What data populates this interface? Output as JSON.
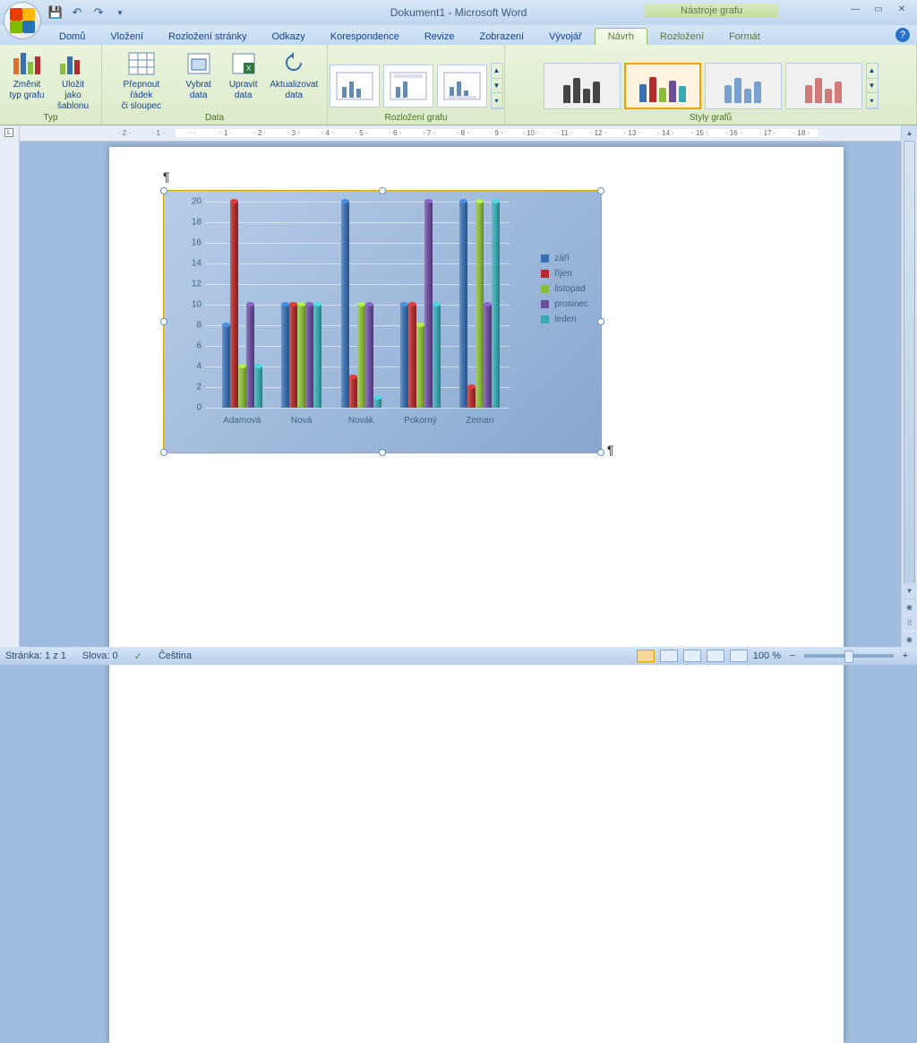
{
  "title": "Dokument1 - Microsoft Word",
  "context_tab_group": "Nástroje grafu",
  "tabs": [
    "Domů",
    "Vložení",
    "Rozložení stránky",
    "Odkazy",
    "Korespondence",
    "Revize",
    "Zobrazení",
    "Vývojář",
    "Návrh",
    "Rozložení",
    "Formát"
  ],
  "active_tab": "Návrh",
  "ribbon": {
    "groups": {
      "typ": {
        "label": "Typ",
        "btn_change": "Změnit\ntyp grafu",
        "btn_save": "Uložit jako\nšablonu"
      },
      "data": {
        "label": "Data",
        "btn_switch": "Přepnout řádek\nči sloupec",
        "btn_select": "Vybrat\ndata",
        "btn_edit": "Upravit\ndata",
        "btn_refresh": "Aktualizovat\ndata"
      },
      "layout": {
        "label": "Rozložení grafu"
      },
      "styles": {
        "label": "Styly grafů"
      }
    }
  },
  "ruler_marks": [
    "2",
    "1",
    "",
    "1",
    "2",
    "3",
    "4",
    "5",
    "6",
    "7",
    "8",
    "9",
    "10",
    "11",
    "12",
    "13",
    "14",
    "15",
    "16",
    "17",
    "18"
  ],
  "chart_data": {
    "type": "bar",
    "categories": [
      "Adamová",
      "Nová",
      "Novák",
      "Pokorný",
      "Zeman"
    ],
    "series": [
      {
        "name": "září",
        "color": "#3a6fb0",
        "values": [
          8,
          10,
          20,
          10,
          20
        ]
      },
      {
        "name": "říjen",
        "color": "#b02e2e",
        "values": [
          20,
          10,
          3,
          10,
          2
        ]
      },
      {
        "name": "listopad",
        "color": "#8bbb3a",
        "values": [
          4,
          10,
          10,
          8,
          20
        ]
      },
      {
        "name": "prosinec",
        "color": "#6a4e9c",
        "values": [
          10,
          10,
          10,
          20,
          10
        ]
      },
      {
        "name": "leden",
        "color": "#3aa8b0",
        "values": [
          4,
          10,
          1,
          10,
          20
        ]
      }
    ],
    "ylim": [
      0,
      20
    ],
    "yticks": [
      0,
      2,
      4,
      6,
      8,
      10,
      12,
      14,
      16,
      18,
      20
    ]
  },
  "status": {
    "page": "Stránka: 1 z 1",
    "words": "Slova: 0",
    "lang": "Čeština",
    "zoom": "100 %"
  }
}
